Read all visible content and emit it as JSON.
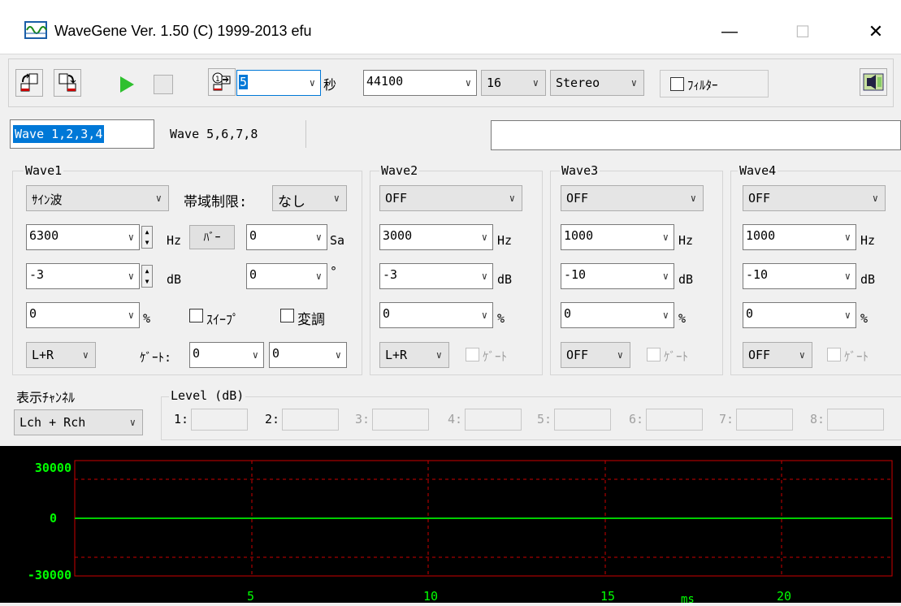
{
  "window": {
    "title": "WaveGene  Ver. 1.50  (C) 1999-2013 efu",
    "minimize": "—",
    "maximize": "☐",
    "close": "✕"
  },
  "toolbar": {
    "duration": "5",
    "duration_unit": "秒",
    "sample_rate": "44100",
    "bits": "16",
    "channels": "Stereo",
    "filter_label": "ﾌｨﾙﾀｰ"
  },
  "tabs": {
    "tab1": "Wave 1,2,3,4",
    "tab2": "Wave 5,6,7,8",
    "status_text": ""
  },
  "wave1": {
    "label": "Wave1",
    "waveform": "ｻｲﾝ波",
    "band_label": "帯域制限:",
    "band_value": "なし",
    "freq": "6300",
    "freq_unit": "Hz",
    "burst": "ﾊﾞｰ",
    "sa_value": "0",
    "sa_unit": "Sa",
    "level": "-3",
    "level_unit": "dB",
    "phase": "0",
    "phase_unit": "°",
    "duty": "0",
    "duty_unit": "%",
    "sweep_label": "ｽｲｰﾌﾟ",
    "mod_label": "変調",
    "output": "L+R",
    "gate_label": "ｹﾞｰﾄ:",
    "gate1": "0",
    "gate2": "0"
  },
  "wave2": {
    "label": "Wave2",
    "waveform": "OFF",
    "freq": "3000",
    "freq_unit": "Hz",
    "level": "-3",
    "level_unit": "dB",
    "duty": "0",
    "duty_unit": "%",
    "output": "L+R",
    "gate_label": "ｹﾞｰﾄ"
  },
  "wave3": {
    "label": "Wave3",
    "waveform": "OFF",
    "freq": "1000",
    "freq_unit": "Hz",
    "level": "-10",
    "level_unit": "dB",
    "duty": "0",
    "duty_unit": "%",
    "output": "OFF",
    "gate_label": "ｹﾞｰﾄ"
  },
  "wave4": {
    "label": "Wave4",
    "waveform": "OFF",
    "freq": "1000",
    "freq_unit": "Hz",
    "level": "-10",
    "level_unit": "dB",
    "duty": "0",
    "duty_unit": "%",
    "output": "OFF",
    "gate_label": "ｹﾞｰﾄ"
  },
  "display": {
    "label": "表示ﾁｬﾝﾈﾙ",
    "value": "Lch + Rch"
  },
  "level_meter": {
    "label": "Level (dB)",
    "channels": [
      "1:",
      "2:",
      "3:",
      "4:",
      "5:",
      "6:",
      "7:",
      "8:"
    ]
  },
  "scope": {
    "y_top": "30000",
    "y_mid": "0",
    "y_bottom": "-30000",
    "x_ticks": [
      "5",
      "10",
      "15",
      "20"
    ],
    "x_unit": "ms",
    "colors": {
      "frame": "#cc0000",
      "grid": "#cc0000",
      "trace": "#00cc00",
      "labels": "#00ff00",
      "bg": "#000000"
    }
  }
}
